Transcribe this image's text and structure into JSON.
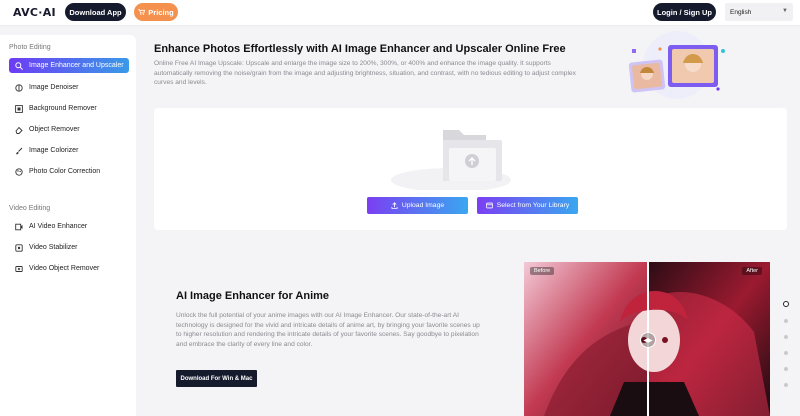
{
  "header": {
    "logo": "AVC·AI",
    "download_app": "Download App",
    "pricing": "Pricing",
    "login": "Login / Sign Up",
    "language": "English"
  },
  "sidebar": {
    "photo_section": "Photo Editing",
    "photo_items": [
      {
        "label": "Image Enhancer and Upscaler",
        "icon": "magnify-icon",
        "active": true
      },
      {
        "label": "Image Denoiser",
        "icon": "denoise-icon"
      },
      {
        "label": "Background Remover",
        "icon": "background-icon"
      },
      {
        "label": "Object Remover",
        "icon": "eraser-icon"
      },
      {
        "label": "Image Colorizer",
        "icon": "brush-icon"
      },
      {
        "label": "Photo Color Correction",
        "icon": "palette-icon"
      }
    ],
    "video_section": "Video Editing",
    "video_items": [
      {
        "label": "AI Video Enhancer",
        "icon": "video-enhance-icon"
      },
      {
        "label": "Video Stabilizer",
        "icon": "stabilizer-icon"
      },
      {
        "label": "Video Object Remover",
        "icon": "video-eraser-icon"
      }
    ]
  },
  "hero": {
    "title": "Enhance Photos Effortlessly with AI Image Enhancer and Upscaler Online Free",
    "description": "Online Free AI Image Upscale: Upscale and enlarge the image size to 200%, 300%, or 400% and enhance the image quality. It supports automatically removing the noise/grain from the image and adjusting brightness, situation, and contrast, with no tedious editing to adjust complex curves and levels."
  },
  "upload": {
    "upload_button": "Upload Image",
    "library_button": "Select from Your Library"
  },
  "feature": {
    "title": "AI Image Enhancer for Anime",
    "description": "Unlock the full potential of your anime images with our AI Image Enhancer. Our state-of-the-art AI technology is designed for the vivid and intricate details of anime art, by bringing your favorite scenes up to higher resolution and rendering the intricate details of your favorite scenes. Say goodbye to pixelation and embrace the clarity of every line and color.",
    "download_button": "Download For Win & Mac",
    "before_label": "Before",
    "after_label": "After"
  },
  "carousel": {
    "count": 6,
    "active_index": 0
  },
  "colors": {
    "accent_start": "#6d3cf5",
    "accent_end": "#3a9ae8",
    "dark_button": "#161a2d",
    "pricing": "#f5914e"
  }
}
